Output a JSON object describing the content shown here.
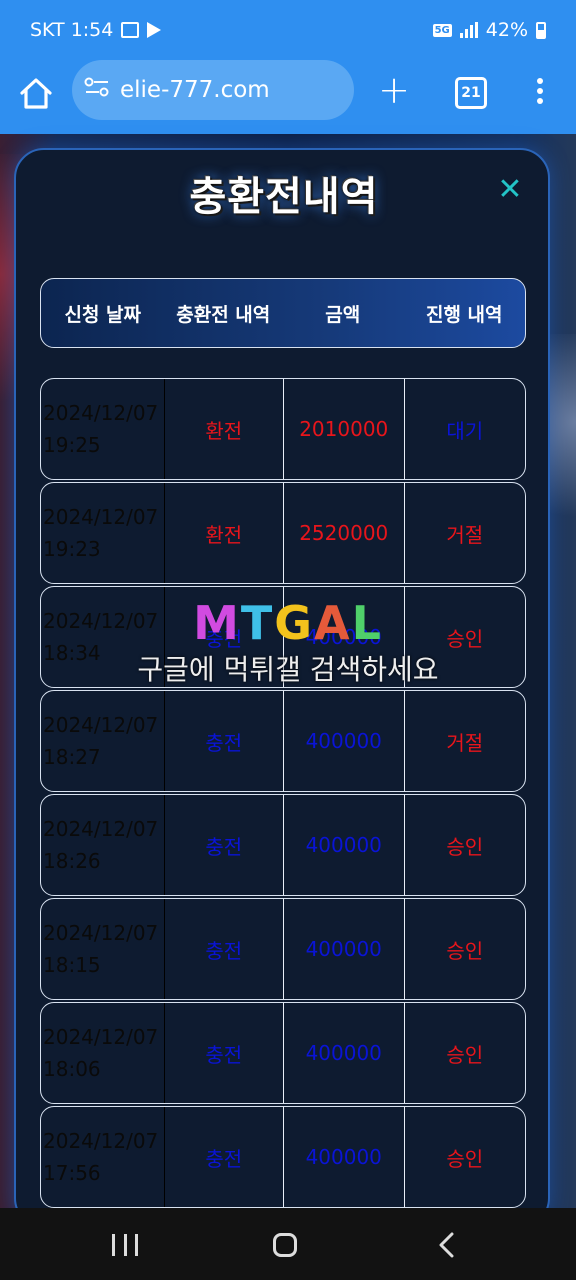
{
  "status_bar": {
    "carrier_time": "SKT 1:54",
    "network": "5G",
    "battery": "42%"
  },
  "browser": {
    "url": "elie-777.com",
    "tab_count": "21"
  },
  "modal": {
    "title": "충환전내역",
    "close_glyph": "✕",
    "headers": [
      "신청 날짜",
      "충환전 내역",
      "금액",
      "진행 내역"
    ],
    "rows": [
      {
        "date": "2024/12/07",
        "time": "19:25",
        "type": "환전",
        "amount": "2010000",
        "status": "대기",
        "type_color": "red",
        "amount_color": "red",
        "status_color": "blue"
      },
      {
        "date": "2024/12/07",
        "time": "19:23",
        "type": "환전",
        "amount": "2520000",
        "status": "거절",
        "type_color": "red",
        "amount_color": "red",
        "status_color": "red"
      },
      {
        "date": "2024/12/07",
        "time": "18:34",
        "type": "충전",
        "amount": "400000",
        "status": "승인",
        "type_color": "blue",
        "amount_color": "blue",
        "status_color": "red"
      },
      {
        "date": "2024/12/07",
        "time": "18:27",
        "type": "충전",
        "amount": "400000",
        "status": "거절",
        "type_color": "blue",
        "amount_color": "blue",
        "status_color": "red"
      },
      {
        "date": "2024/12/07",
        "time": "18:26",
        "type": "충전",
        "amount": "400000",
        "status": "승인",
        "type_color": "blue",
        "amount_color": "blue",
        "status_color": "red"
      },
      {
        "date": "2024/12/07",
        "time": "18:15",
        "type": "충전",
        "amount": "400000",
        "status": "승인",
        "type_color": "blue",
        "amount_color": "blue",
        "status_color": "red"
      },
      {
        "date": "2024/12/07",
        "time": "18:06",
        "type": "충전",
        "amount": "400000",
        "status": "승인",
        "type_color": "blue",
        "amount_color": "blue",
        "status_color": "red"
      },
      {
        "date": "2024/12/07",
        "time": "17:56",
        "type": "충전",
        "amount": "400000",
        "status": "승인",
        "type_color": "blue",
        "amount_color": "blue",
        "status_color": "red"
      }
    ]
  },
  "watermark": {
    "logo": [
      "M",
      "T",
      "G",
      "A",
      "L"
    ],
    "text": "구글에 먹튀갤 검색하세요"
  },
  "colors": {
    "red": "#e8151b",
    "blue": "#0a14d6",
    "accent": "#2f8ff0"
  },
  "icons": [
    "home-icon",
    "tune-icon",
    "plus-icon",
    "tabs-icon",
    "more-vert-icon",
    "close-icon",
    "recent-apps-icon",
    "home-nav-icon",
    "back-icon"
  ]
}
